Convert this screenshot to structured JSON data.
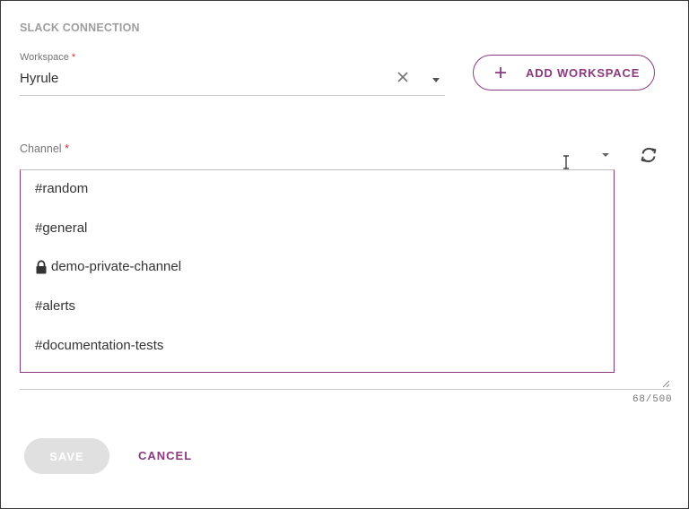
{
  "section_title": "SLACK CONNECTION",
  "workspace": {
    "label": "Workspace",
    "required_mark": "*",
    "value": "Hyrule",
    "clear_icon": "close-icon",
    "dropdown_icon": "caret-down-icon"
  },
  "add_workspace_button": {
    "icon": "plus-icon",
    "label": "ADD WORKSPACE"
  },
  "channel": {
    "label": "Channel",
    "required_mark": "*",
    "dropdown_icon": "caret-down-icon",
    "refresh_icon": "refresh-icon",
    "options": [
      {
        "label": "#random",
        "icon": null
      },
      {
        "label": "#general",
        "icon": null
      },
      {
        "label": "demo-private-channel",
        "icon": "lock-icon"
      },
      {
        "label": "#alerts",
        "icon": null
      },
      {
        "label": "#documentation-tests",
        "icon": null
      }
    ]
  },
  "message": {
    "counter": "68/500"
  },
  "actions": {
    "save_label": "SAVE",
    "cancel_label": "CANCEL"
  },
  "colors": {
    "accent": "#8b3a7f",
    "required": "#d32f2f",
    "disabled_bg": "#e0e0e0"
  }
}
